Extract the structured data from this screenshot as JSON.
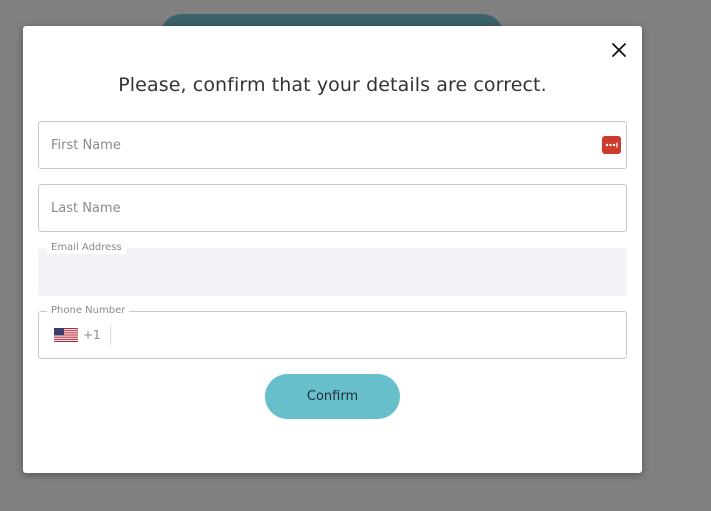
{
  "modal": {
    "title": "Please, confirm that your details are correct.",
    "close_icon": "close-icon",
    "confirm_label": "Confirm"
  },
  "form": {
    "first_name": {
      "placeholder": "First Name",
      "value": ""
    },
    "last_name": {
      "placeholder": "Last Name",
      "value": ""
    },
    "email": {
      "label": "Email Address",
      "value": ""
    },
    "phone": {
      "label": "Phone Number",
      "country_flag": "us-flag-icon",
      "dial_code": "+1",
      "value": ""
    }
  },
  "colors": {
    "overlay": "#808080",
    "modal_bg": "#ffffff",
    "accent": "#67bfcb",
    "behind_button": "#3c6168",
    "password_badge": "#cc3b2c",
    "filled_field": "#f2f2f7"
  }
}
